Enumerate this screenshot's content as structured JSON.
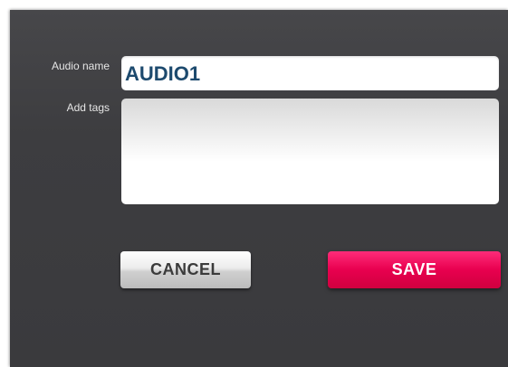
{
  "form": {
    "audio_name_label": "Audio name",
    "audio_name_value": "AUDIO1",
    "add_tags_label": "Add tags",
    "add_tags_value": ""
  },
  "buttons": {
    "cancel_label": "CANCEL",
    "save_label": "SAVE"
  },
  "colors": {
    "panel_background": "#3d3d40",
    "save_accent": "#e8004f",
    "input_text": "#1d4a6e"
  }
}
